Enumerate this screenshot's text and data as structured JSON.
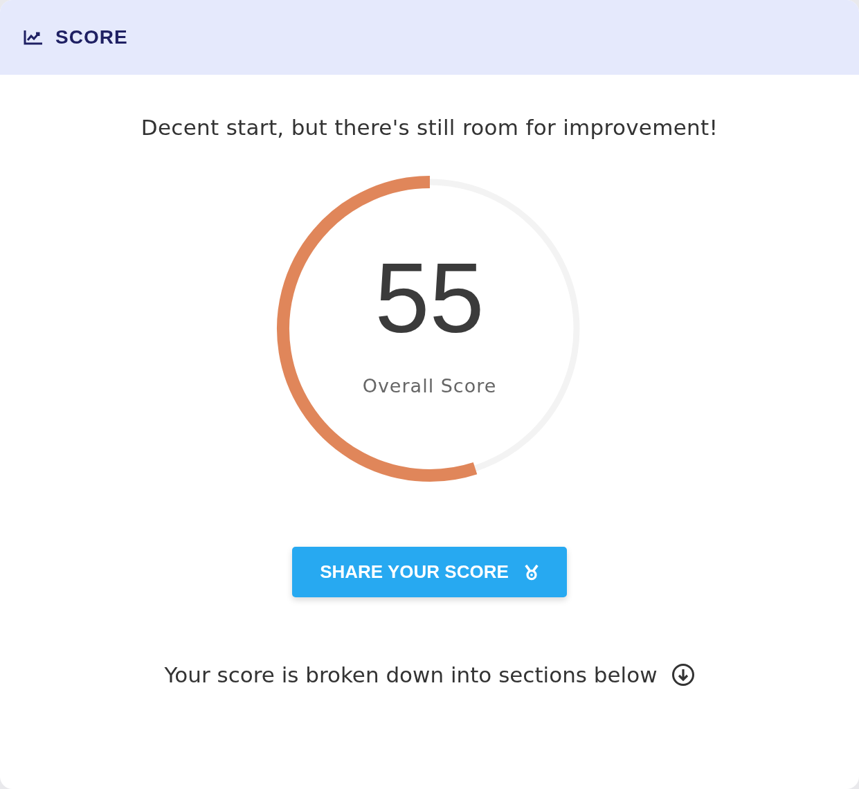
{
  "header": {
    "title": "SCORE"
  },
  "message": "Decent start, but there's still room for improvement!",
  "gauge": {
    "value": "55",
    "label": "Overall Score"
  },
  "share_button": {
    "label": "SHARE YOUR SCORE"
  },
  "footer_note": "Your score is broken down into sections below"
}
